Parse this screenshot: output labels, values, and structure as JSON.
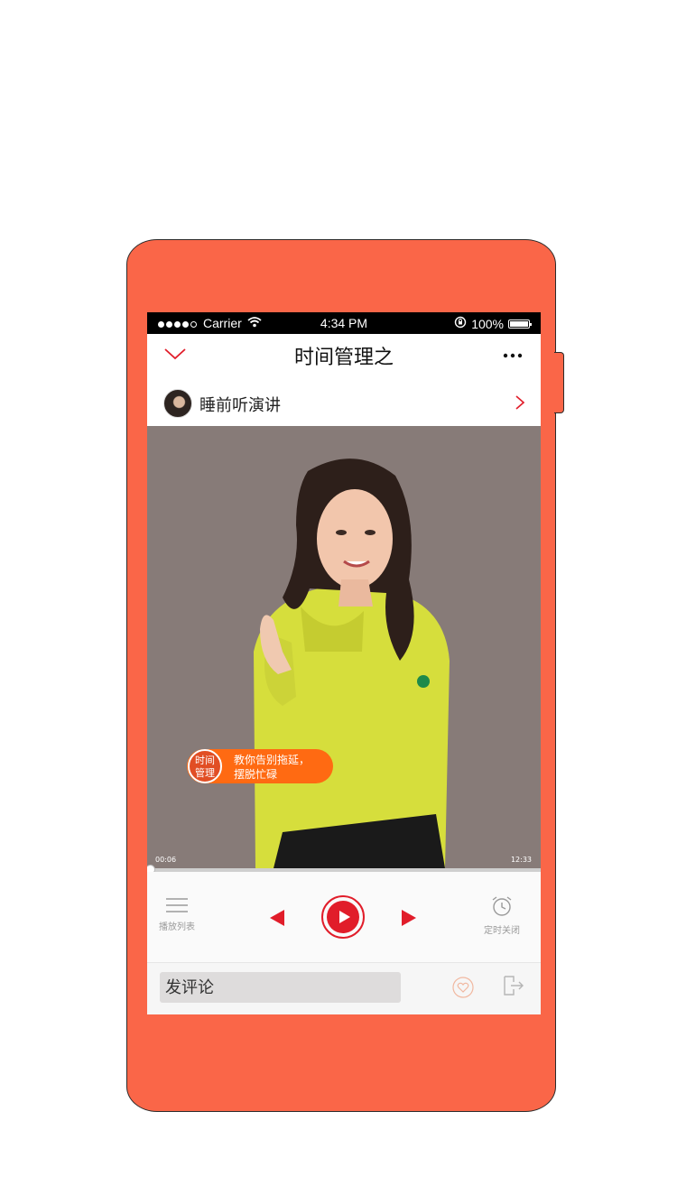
{
  "status_bar": {
    "carrier": "Carrier",
    "time": "4:34 PM",
    "battery": "100%"
  },
  "nav": {
    "title": "时间管理之"
  },
  "album": {
    "name": "睡前听演讲"
  },
  "cover": {
    "tag_badge": [
      "时间",
      "管理"
    ],
    "tag_text": [
      "教你告别拖延，",
      "摆脱忙碌"
    ]
  },
  "player": {
    "current_time": "00:06",
    "total_time": "12:33",
    "progress": 0.008,
    "playlist_label": "播放列表",
    "timer_label": "定时关闭"
  },
  "comment": {
    "placeholder": "发评论"
  },
  "colors": {
    "accent": "#e11d2a",
    "phone_body": "#fa6648",
    "tag_orange": "#ff6a12"
  }
}
